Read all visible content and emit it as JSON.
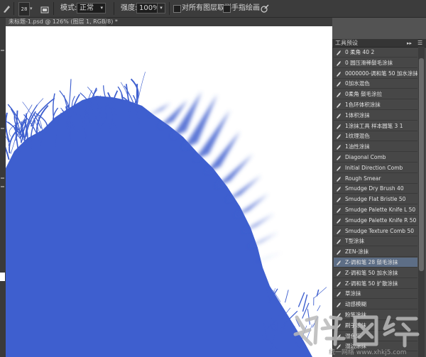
{
  "options_bar": {
    "brush_size": "28",
    "mode_label": "模式:",
    "mode_value": "正常",
    "strength_label": "强度:",
    "strength_value": "100%",
    "sample_all_layers_label": "对所有图层取样",
    "finger_painting_label": "手指绘画"
  },
  "document": {
    "tab_title": "未标题-1.psd @ 126% (图层 1, RGB/8) *"
  },
  "paint_color": "#3e5fcf",
  "panel": {
    "title": "工具预设",
    "selected_index": 20,
    "items": [
      "0 柔角 40 2",
      "0 圆压滑稀鬃毛涂抹",
      "0000000-调和笔 50 加水涂抹",
      "0加水混色",
      "0柔角 鬃毛涂拉",
      "1色环体积涂抹",
      "1体积涂抹",
      "1涂抹工具 样本圆笔 3 1",
      "1纹理混色",
      "1油性涂抹",
      "Diagonal Comb",
      "Initial Direction Comb",
      "Rough Smear",
      "Smudge  Dry Brush 40",
      "Smudge  Flat Bristle 50",
      "Smudge Palette Knife L 50",
      "Smudge Palette Knife R 50",
      "Smudge Texture Comb 50",
      "T型涂抹",
      "ZEN-涂抹",
      "Z-调和笔 28 鬃毛涂抹",
      "Z-调和笔 50 加水涂抹",
      "Z-调和笔 50 扩散涂抹",
      "草涂抹",
      "动感模糊",
      "粉笔涂抹",
      "刷子涂抹",
      "湿色采",
      "湿边涂抹"
    ]
  },
  "watermark_text": "统一网络 www.xhkj5.com"
}
